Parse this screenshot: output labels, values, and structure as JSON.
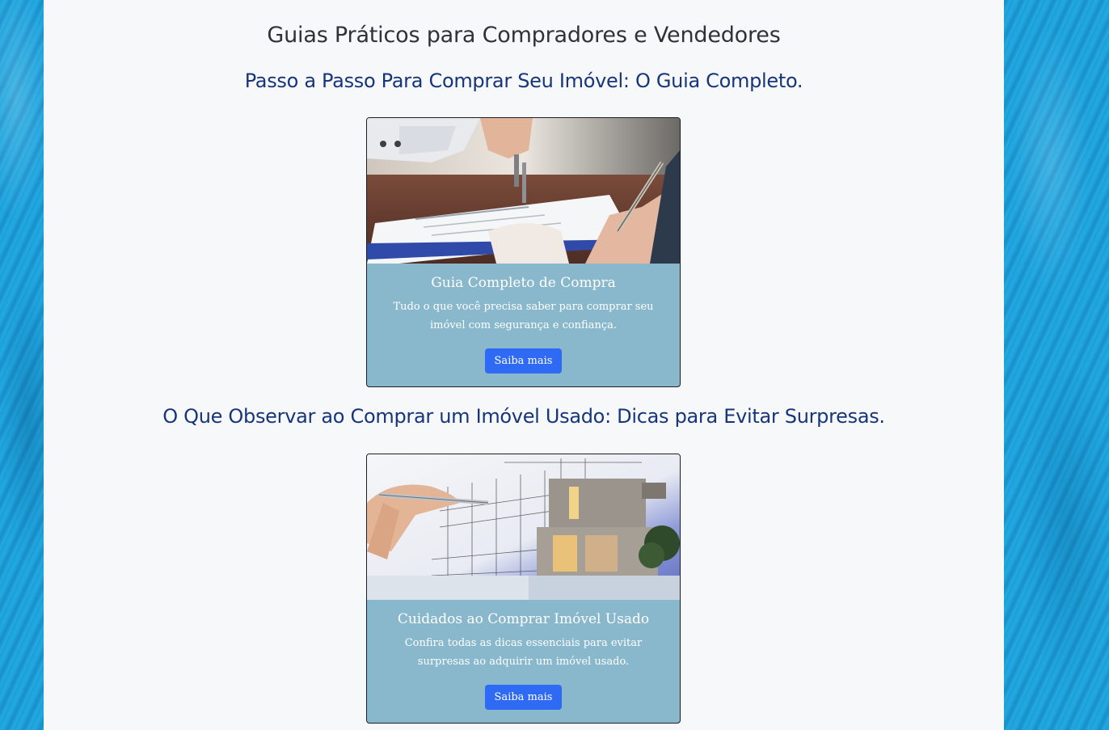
{
  "page": {
    "title": "Guias Práticos para Compradores e Vendedores"
  },
  "sections": [
    {
      "heading": "Passo a Passo Para Comprar Seu Imóvel: O Guia Completo.",
      "card": {
        "image_alt": "handing-over-keys-signing-contract",
        "title": "Guia Completo de Compra",
        "text": "Tudo o que você precisa saber para comprar seu imóvel com segurança e confiança.",
        "button_label": "Saiba mais"
      }
    },
    {
      "heading": "O Que Observar ao Comprar um Imóvel Usado: Dicas para Evitar Surpresas.",
      "card": {
        "image_alt": "architect-sketch-modern-house",
        "title": "Cuidados ao Comprar Imóvel Usado",
        "text": "Confira todas as dicas essenciais para evitar surpresas ao adquirir um imóvel usado.",
        "button_label": "Saiba mais"
      }
    }
  ],
  "colors": {
    "background": "#1a9ed8",
    "container": "#f7f8fa",
    "heading": "#16357a",
    "card_body": "#89b8cd",
    "button": "#2f6af5"
  }
}
